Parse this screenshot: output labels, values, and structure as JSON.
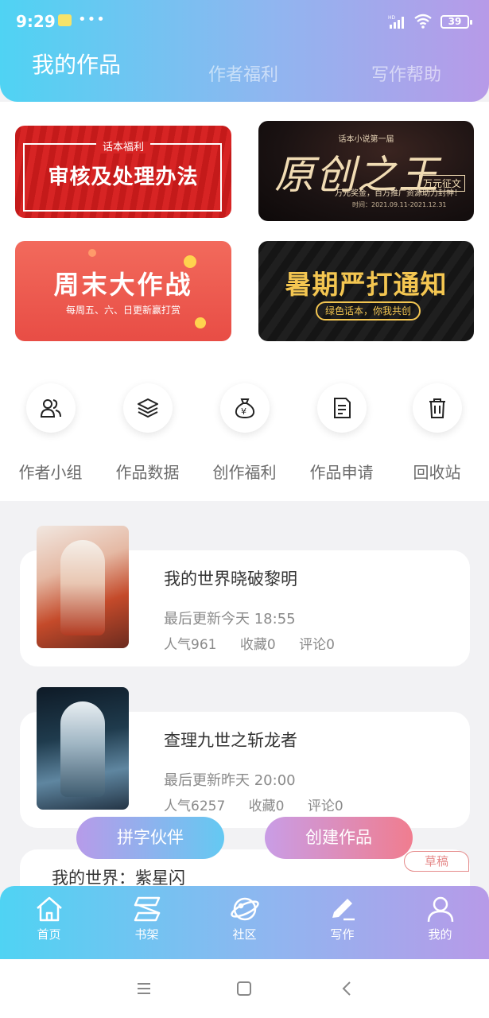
{
  "status": {
    "time": "9:29",
    "dots": "•••",
    "battery": "39",
    "network": "HD"
  },
  "header": {
    "tabs": [
      {
        "label": "我的作品"
      },
      {
        "label": "作者福利"
      },
      {
        "label": "写作帮助"
      }
    ]
  },
  "banners": {
    "b1": {
      "sub": "话本福利",
      "main": "审核及处理办法"
    },
    "b2": {
      "top": "话本小说第一届",
      "main": "原创之王",
      "tag": "万元征文",
      "line": "万元奖金，百万推广资源助力封神！",
      "date": "时间：2021.09.11-2021.12.31"
    },
    "b3": {
      "main": "周末大作战",
      "sub": "每周五、六、日更新赢打赏"
    },
    "b4": {
      "main": "暑期严打通知",
      "pill": "绿色话本，你我共创"
    }
  },
  "quick_actions": [
    {
      "label": "作者小组",
      "icon": "group-icon"
    },
    {
      "label": "作品数据",
      "icon": "layers-icon"
    },
    {
      "label": "创作福利",
      "icon": "money-bag-icon"
    },
    {
      "label": "作品申请",
      "icon": "document-icon"
    },
    {
      "label": "回收站",
      "icon": "trash-icon"
    }
  ],
  "works": [
    {
      "title": "我的世界晓破黎明",
      "update": "最后更新今天 18:55",
      "popularity": "人气961",
      "favorites": "收藏0",
      "comments": "评论0"
    },
    {
      "title": "查理九世之斩龙者",
      "update": "最后更新昨天 20:00",
      "popularity": "人气6257",
      "favorites": "收藏0",
      "comments": "评论0"
    },
    {
      "title": "我的世界：紫星闪",
      "badge": "草稿"
    }
  ],
  "actions": {
    "partner": "拼字伙伴",
    "create": "创建作品"
  },
  "bottom_nav": [
    {
      "label": "首页",
      "icon": "home-icon"
    },
    {
      "label": "书架",
      "icon": "bookshelf-icon"
    },
    {
      "label": "社区",
      "icon": "planet-icon"
    },
    {
      "label": "写作",
      "icon": "pen-icon"
    },
    {
      "label": "我的",
      "icon": "profile-icon"
    }
  ]
}
